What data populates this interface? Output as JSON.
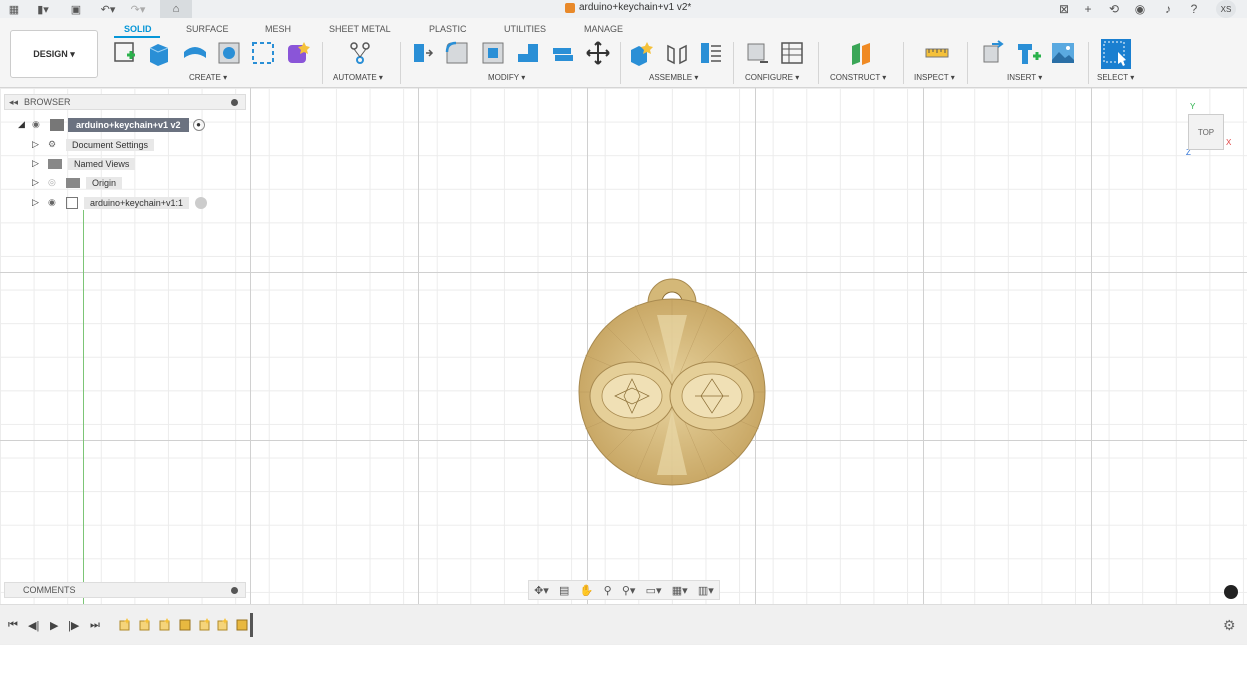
{
  "titlebar": {
    "document_title": "arduino+keychain+v1 v2*",
    "user_initials": "XS"
  },
  "ribbon": {
    "workspace_button": "DESIGN ▾",
    "tabs": [
      "SOLID",
      "SURFACE",
      "MESH",
      "SHEET METAL",
      "PLASTIC",
      "UTILITIES",
      "MANAGE"
    ],
    "active_tab": "SOLID",
    "groups": [
      "CREATE ▾",
      "AUTOMATE ▾",
      "MODIFY ▾",
      "ASSEMBLE ▾",
      "CONFIGURE ▾",
      "CONSTRUCT ▾",
      "INSPECT ▾",
      "INSERT ▾",
      "SELECT ▾"
    ]
  },
  "browser": {
    "header": "BROWSER",
    "root": "arduino+keychain+v1 v2",
    "items": [
      "Document Settings",
      "Named Views",
      "Origin",
      "arduino+keychain+v1:1"
    ]
  },
  "viewcube": {
    "face": "TOP"
  },
  "comments": {
    "label": "COMMENTS"
  },
  "colors": {
    "accent": "#0696d7",
    "model": "#d9bf85",
    "grid": "#ececec"
  }
}
